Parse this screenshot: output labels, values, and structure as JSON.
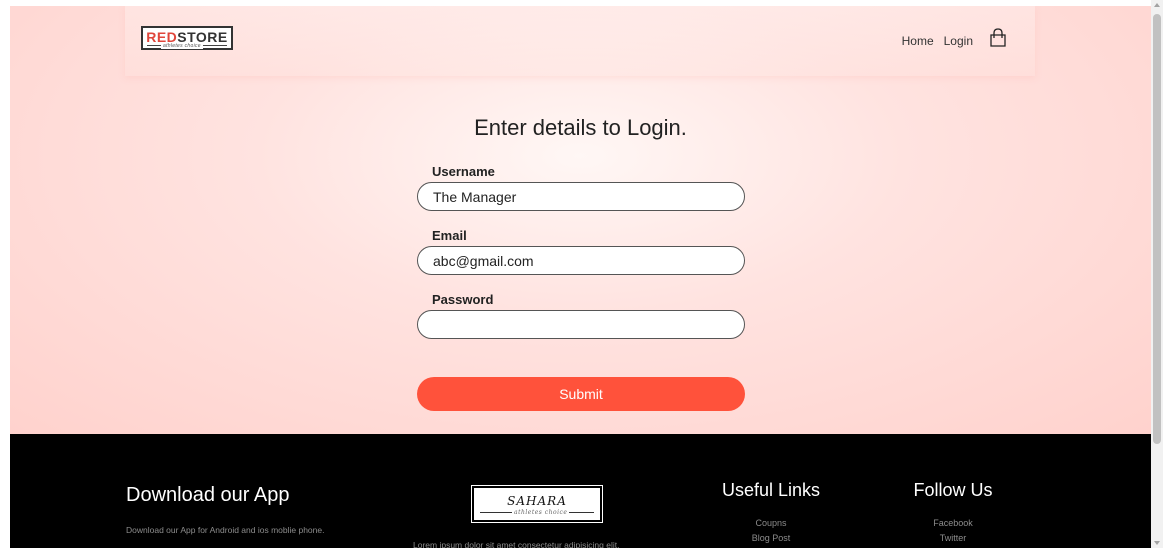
{
  "navbar": {
    "logo_text_red": "RED",
    "logo_text_dark": "STORE",
    "logo_tagline": "athletes choice",
    "links": [
      "Home",
      "Login"
    ],
    "cart_icon": "shopping-bag-icon"
  },
  "login": {
    "title": "Enter details to Login.",
    "username_label": "Username",
    "username_value": "The Manager",
    "email_label": "Email",
    "email_value": "abc@gmail.com",
    "password_label": "Password",
    "password_value": "",
    "submit_label": "Submit"
  },
  "footer": {
    "app_title": "Download our App",
    "app_text": "Download our App for Android and ios moblie phone.",
    "logo_text": "SAHARA",
    "logo_tagline": "athletes choice",
    "lorem": "Lorem ipsum dolor sit amet consectetur adipisicing elit.",
    "useful_links_title": "Useful Links",
    "useful_links": [
      "Coupns",
      "Blog Post"
    ],
    "follow_title": "Follow Us",
    "follow_links": [
      "Facebook",
      "Twitter"
    ]
  },
  "colors": {
    "accent": "#ff523b",
    "hero_bg": "#ffe3e0",
    "footer_bg": "#000000"
  }
}
